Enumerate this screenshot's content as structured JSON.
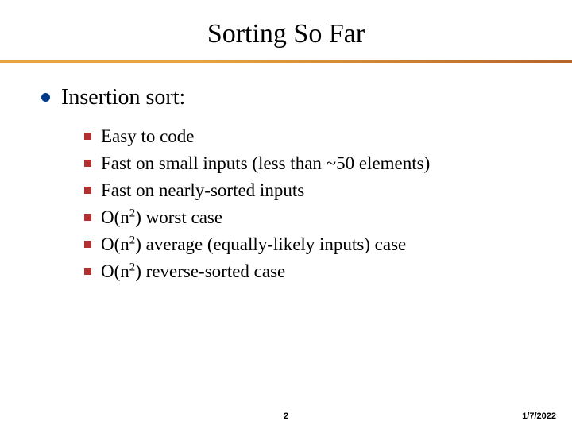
{
  "title": "Sorting So Far",
  "main_bullet": "Insertion sort:",
  "sub_bullets": [
    {
      "pre": "Easy to code",
      "sup": "",
      "post": ""
    },
    {
      "pre": "Fast on small inputs (less than ~50 elements)",
      "sup": "",
      "post": ""
    },
    {
      "pre": "Fast on nearly-sorted inputs",
      "sup": "",
      "post": ""
    },
    {
      "pre": "O(n",
      "sup": "2",
      "post": ") worst case"
    },
    {
      "pre": "O(n",
      "sup": "2",
      "post": ") average (equally-likely inputs) case"
    },
    {
      "pre": "O(n",
      "sup": "2",
      "post": ") reverse-sorted case"
    }
  ],
  "page_number": "2",
  "date": "1/7/2022"
}
